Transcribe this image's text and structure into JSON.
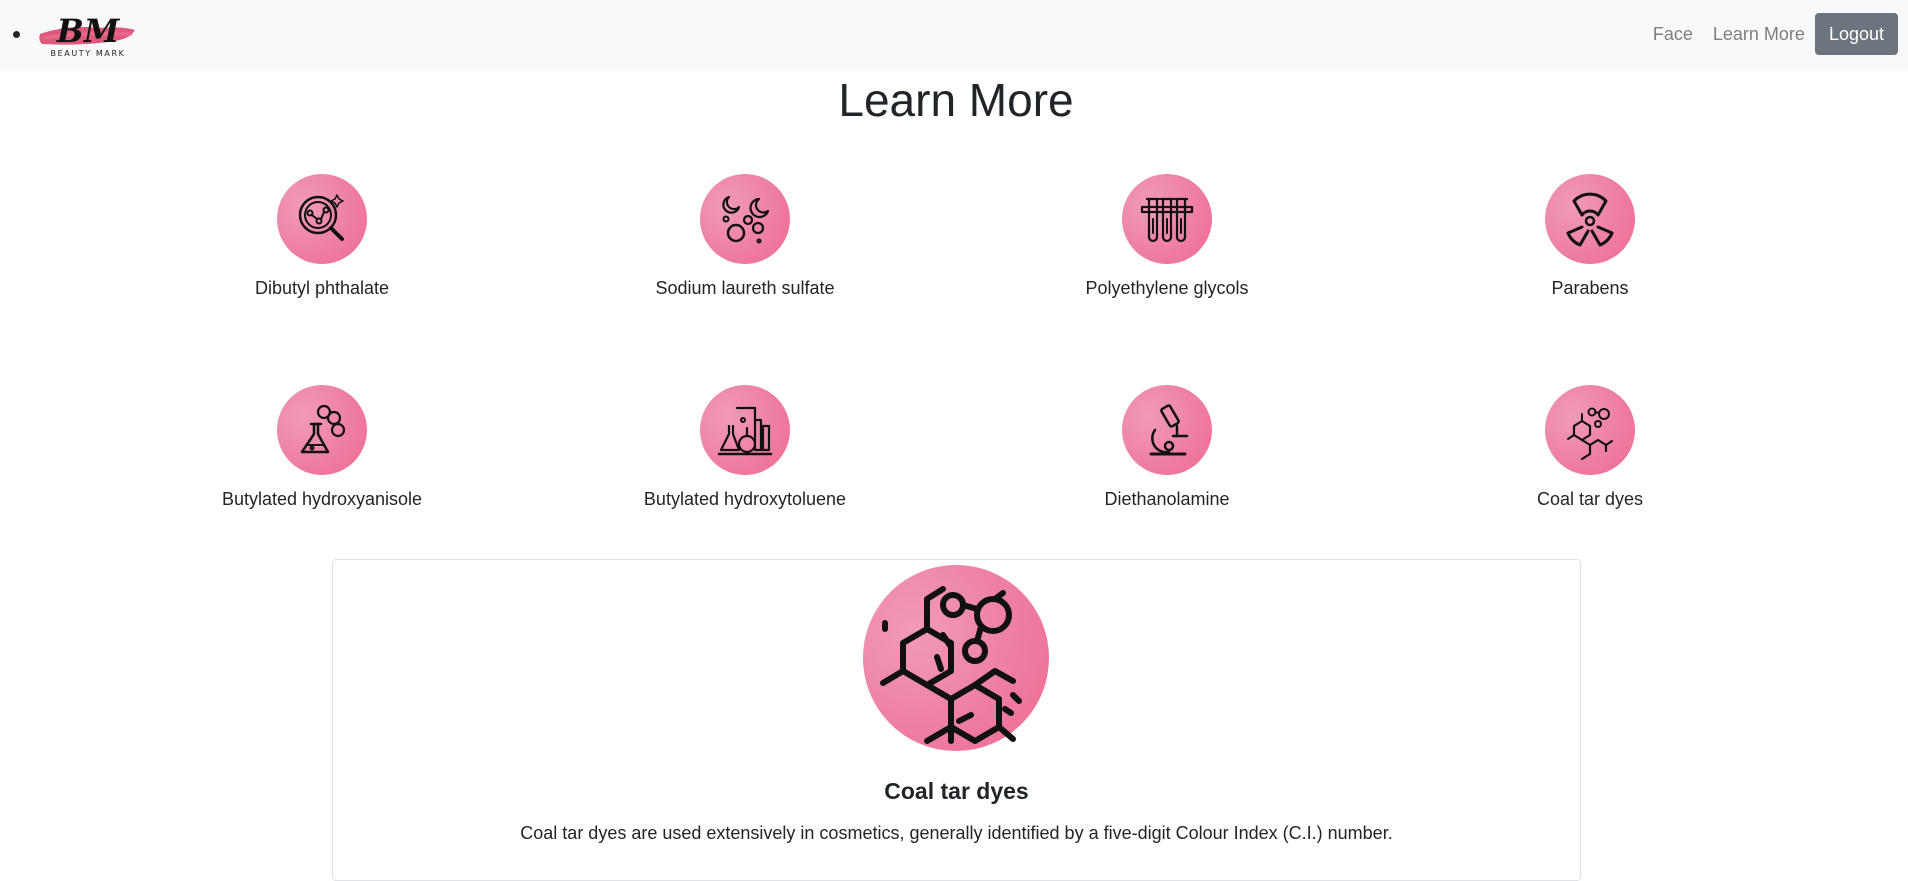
{
  "nav": {
    "brand_initials": "BM",
    "brand_text": "BEAUTY MARK",
    "links": [
      "Face",
      "Learn More"
    ],
    "logout_label": "Logout"
  },
  "page": {
    "title": "Learn More"
  },
  "ingredients": [
    {
      "label": "Dibutyl phthalate",
      "icon": "magnifier-molecule-icon"
    },
    {
      "label": "Sodium laureth sulfate",
      "icon": "bubbles-icon"
    },
    {
      "label": "Polyethylene glycols",
      "icon": "test-tubes-icon"
    },
    {
      "label": "Parabens",
      "icon": "radiation-icon"
    },
    {
      "label": "Butylated hydroxyanisole",
      "icon": "flask-icon"
    },
    {
      "label": "Butylated hydroxytoluene",
      "icon": "lab-equipment-icon"
    },
    {
      "label": "Diethanolamine",
      "icon": "microscope-icon"
    },
    {
      "label": "Coal tar dyes",
      "icon": "molecule-icon"
    }
  ],
  "detail": {
    "title": "Coal tar dyes",
    "description": "Coal tar dyes are used extensively in cosmetics, generally identified by a five-digit Colour Index (C.I.) number.",
    "icon": "molecule-icon"
  },
  "colors": {
    "accent_pink": "#ee7fa4",
    "navbar_bg": "#f8f9fa",
    "logout_bg": "#6c757d",
    "brand_stroke": "#d9486f"
  }
}
